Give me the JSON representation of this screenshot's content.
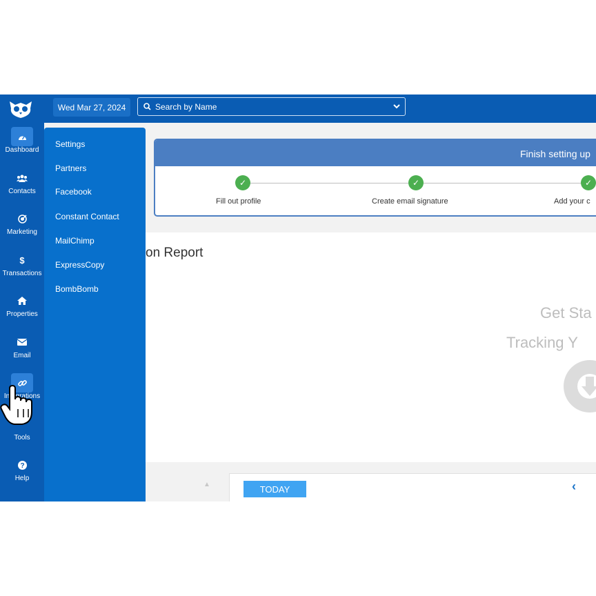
{
  "topbar": {
    "date": "Wed Mar 27, 2024",
    "search_placeholder": "Search by Name"
  },
  "rail": {
    "items": [
      {
        "label": "Dashboard",
        "icon": "dashboard-gauge-icon"
      },
      {
        "label": "Contacts",
        "icon": "users-icon"
      },
      {
        "label": "Marketing",
        "icon": "marketing-target-icon"
      },
      {
        "label": "Transactions",
        "icon": "dollar-icon"
      },
      {
        "label": "Properties",
        "icon": "home-icon"
      },
      {
        "label": "Email",
        "icon": "envelope-icon"
      },
      {
        "label": "Integrations",
        "icon": "link-icon",
        "active": true
      },
      {
        "label": "Tools",
        "icon": "tools-icon"
      },
      {
        "label": "Help",
        "icon": "question-icon"
      }
    ]
  },
  "flyout": {
    "items": [
      "Settings",
      "Partners",
      "Facebook",
      "Constant Contact",
      "MailChimp",
      "ExpressCopy",
      "BombBomb"
    ]
  },
  "setup": {
    "title": "Finish setting up",
    "steps": [
      "Fill out profile",
      "Create email signature",
      "Add your c"
    ]
  },
  "main": {
    "report_title": "on Report",
    "get_started": "Get Sta",
    "tracking": "Tracking Y",
    "today_button": "TODAY"
  },
  "colors": {
    "brand_blue": "#0a5cb3",
    "flyout_blue": "#0870cc",
    "setup_header": "#4b7ec2",
    "step_done": "#4caf50",
    "today_button": "#40a4f2"
  }
}
